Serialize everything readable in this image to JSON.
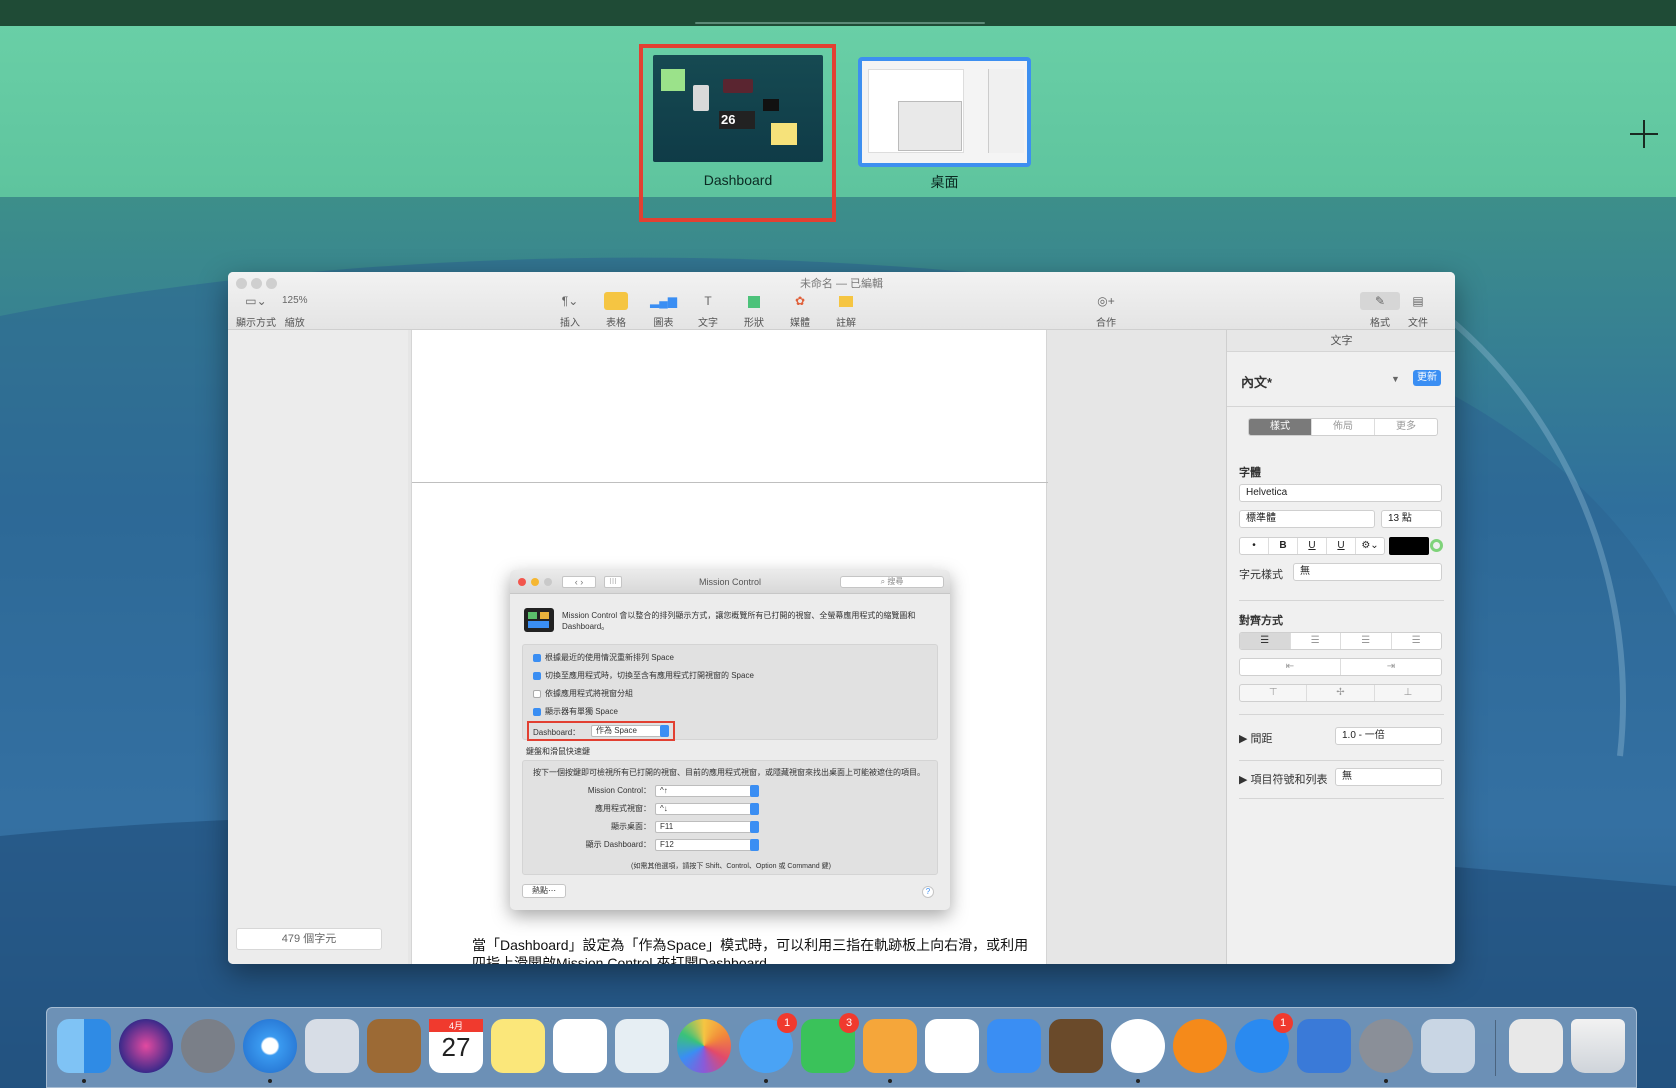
{
  "spaces": {
    "items": [
      {
        "label": "Dashboard"
      },
      {
        "label": "桌面"
      }
    ]
  },
  "pages": {
    "title": "未命名 — 已編輯",
    "toolbar": {
      "view": "顯示方式",
      "zoom_value": "125%",
      "zoom": "縮放",
      "insert": "插入",
      "table": "表格",
      "chart": "圖表",
      "text": "文字",
      "shape": "形狀",
      "media": "媒體",
      "comment": "註解",
      "collaborate": "合作",
      "format": "格式",
      "document": "文件"
    },
    "char_count": "479 個字元",
    "doc_text": "當「Dashboard」設定為「作為Space」模式時，可以利用三指在軌跡板上向右滑，或利用四指上滑開啟Mission Control 來打開Dashboard。",
    "inspector": {
      "header": "文字",
      "style": "內文*",
      "update": "更新",
      "tabs": [
        "樣式",
        "佈局",
        "更多"
      ],
      "font_label": "字體",
      "font": "Helvetica",
      "font_style": "標準體",
      "font_size": "13 點",
      "bold": "B",
      "italic": "•",
      "underline": "U",
      "strike": "U",
      "char_style_label": "字元樣式",
      "char_style": "無",
      "align_label": "對齊方式",
      "spacing_label": "間距",
      "spacing": "1.0 - 一倍",
      "bullets_label": "項目符號和列表",
      "bullets": "無"
    }
  },
  "mission_control": {
    "title": "Mission Control",
    "search": "搜尋",
    "desc": "Mission Control 會以整合的排列顯示方式，讓您概覽所有已打開的視窗、全螢幕應用程式的縮覽圖和 Dashboard。",
    "options": [
      {
        "label": "根據最近的使用情況重新排列 Space",
        "checked": true
      },
      {
        "label": "切換至應用程式時，切換至含有應用程式打開視窗的 Space",
        "checked": true
      },
      {
        "label": "依據應用程式將視窗分組",
        "checked": false
      },
      {
        "label": "顯示器有單獨 Space",
        "checked": true
      }
    ],
    "dashboard_label": "Dashboard：",
    "dashboard_value": "作為 Space",
    "shortcuts_title": "鍵盤和滑鼠快速鍵",
    "shortcuts_desc": "按下一個按鍵即可檢視所有已打開的視窗、目前的應用程式視窗，或隱藏視窗來找出桌面上可能被遮住的項目。",
    "shortcuts": [
      {
        "label": "Mission Control：",
        "value": "^↑"
      },
      {
        "label": "應用程式視窗：",
        "value": "^↓"
      },
      {
        "label": "顯示桌面：",
        "value": "F11"
      },
      {
        "label": "顯示 Dashboard：",
        "value": "F12"
      }
    ],
    "shortcut_note": "(如需其他選項，請按下 Shift、Control、Option 或 Command 鍵)",
    "hot_corners": "熱點⋯",
    "help": "?"
  },
  "dashboard_thumb": {
    "date": "26"
  },
  "dock": {
    "calendar_month": "4月",
    "calendar_day": "27",
    "badges": {
      "messages": "1",
      "facetime": "3",
      "appstore": "1"
    }
  }
}
